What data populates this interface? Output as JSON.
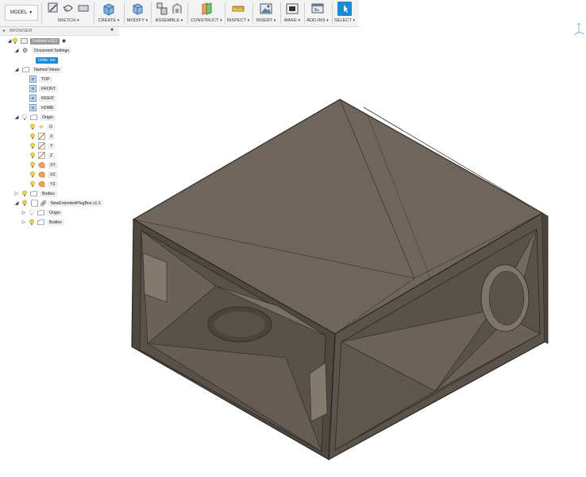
{
  "toolbar": {
    "model_label": "MODEL",
    "groups": {
      "sketch": "SKETCH",
      "create": "CREATE",
      "modify": "MODIFY",
      "assemble": "ASSEMBLE",
      "construct": "CONSTRUCT",
      "inspect": "INSPECT",
      "insert": "INSERT",
      "make": "MAKE",
      "addins": "ADD-INS",
      "select": "SELECT"
    }
  },
  "browser": {
    "title": "BROWSER",
    "document_name": "Untitled v1(1)",
    "document_settings": "Document Settings",
    "units": "Units: cm",
    "named_views": "Named Views",
    "views": [
      "TOP",
      "FRONT",
      "RIGHT",
      "HOME"
    ],
    "origin": "Origin",
    "origin_items": [
      "O",
      "X",
      "Y",
      "Z",
      "XY",
      "XZ",
      "YZ"
    ],
    "bodies": "Bodies",
    "component": "NewExtendedPlugBox v1:1",
    "component_origin": "Origin",
    "component_bodies": "Bodies"
  },
  "colors": {
    "accent": "#1e88d2",
    "model_body": "#6e665c",
    "toolbar_bg": "#f3f3f3"
  },
  "icons": {
    "viewcube": "viewcube-axis-icon",
    "bulb": "lightbulb-icon",
    "folder": "folder-icon",
    "gear": "gear-icon"
  }
}
